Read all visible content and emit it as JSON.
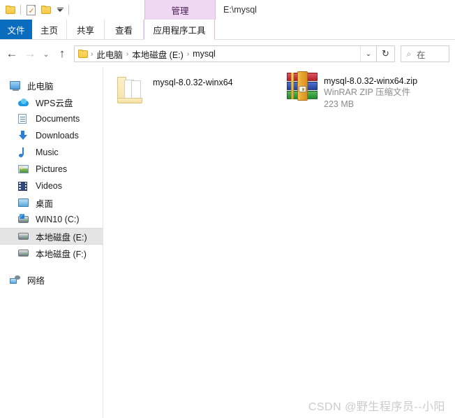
{
  "window": {
    "title": "E:\\mysql",
    "contextual_tab_group": "管理"
  },
  "quick_access_toolbar": {
    "items": [
      {
        "name": "folder-icon",
        "label": ""
      },
      {
        "name": "properties-icon",
        "label": ""
      },
      {
        "name": "new-folder-icon",
        "label": ""
      },
      {
        "name": "customize-qat-dropdown",
        "label": ""
      }
    ]
  },
  "ribbon": {
    "tabs": [
      {
        "id": "file",
        "label": "文件",
        "active": false,
        "accent": "#0a6cbd"
      },
      {
        "id": "home",
        "label": "主页",
        "active": false
      },
      {
        "id": "share",
        "label": "共享",
        "active": false
      },
      {
        "id": "view",
        "label": "查看",
        "active": false
      },
      {
        "id": "apptools",
        "label": "应用程序工具",
        "active": true,
        "accent": "#eed8f2"
      }
    ]
  },
  "address_bar": {
    "back_label": "←",
    "forward_label": "→",
    "recent_label": "⌄",
    "up_label": "↑",
    "breadcrumbs": [
      {
        "label": "此电脑"
      },
      {
        "label": "本地磁盘 (E:)"
      },
      {
        "label": "mysql"
      }
    ],
    "separator": "›",
    "dropdown_label": "⌄",
    "refresh_label": "↻"
  },
  "search": {
    "icon": "search-icon",
    "placeholder": "在 mysql 中搜索",
    "visible_text": "在"
  },
  "sidebar": {
    "items": [
      {
        "id": "this-pc",
        "label": "此电脑",
        "icon": "monitor-icon",
        "indent": false,
        "selected": false
      },
      {
        "id": "wps-cloud",
        "label": "WPS云盘",
        "icon": "cloud-icon",
        "indent": true,
        "selected": false
      },
      {
        "id": "documents",
        "label": "Documents",
        "icon": "document-icon",
        "indent": true,
        "selected": false
      },
      {
        "id": "downloads",
        "label": "Downloads",
        "icon": "download-icon",
        "indent": true,
        "selected": false
      },
      {
        "id": "music",
        "label": "Music",
        "icon": "music-icon",
        "indent": true,
        "selected": false
      },
      {
        "id": "pictures",
        "label": "Pictures",
        "icon": "picture-icon",
        "indent": true,
        "selected": false
      },
      {
        "id": "videos",
        "label": "Videos",
        "icon": "video-icon",
        "indent": true,
        "selected": false
      },
      {
        "id": "desktop",
        "label": "桌面",
        "icon": "desktop-icon",
        "indent": true,
        "selected": false
      },
      {
        "id": "drive-c",
        "label": "WIN10 (C:)",
        "icon": "drive-win-icon",
        "indent": true,
        "selected": false
      },
      {
        "id": "drive-e",
        "label": "本地磁盘 (E:)",
        "icon": "drive-icon",
        "indent": true,
        "selected": true
      },
      {
        "id": "drive-f",
        "label": "本地磁盘 (F:)",
        "icon": "drive-icon",
        "indent": true,
        "selected": false
      },
      {
        "id": "network",
        "label": "网络",
        "icon": "network-icon",
        "indent": false,
        "selected": false
      }
    ]
  },
  "files": [
    {
      "id": "mysql-folder",
      "name": "mysql-8.0.32-winx64",
      "type": "",
      "size": "",
      "icon": "folder-icon"
    },
    {
      "id": "mysql-zip",
      "name": "mysql-8.0.32-winx64.zip",
      "type": "WinRAR ZIP 压缩文件",
      "size": "223 MB",
      "icon": "winrar-zip-icon"
    }
  ],
  "watermark": {
    "text": "CSDN @野生程序员--小阳"
  }
}
